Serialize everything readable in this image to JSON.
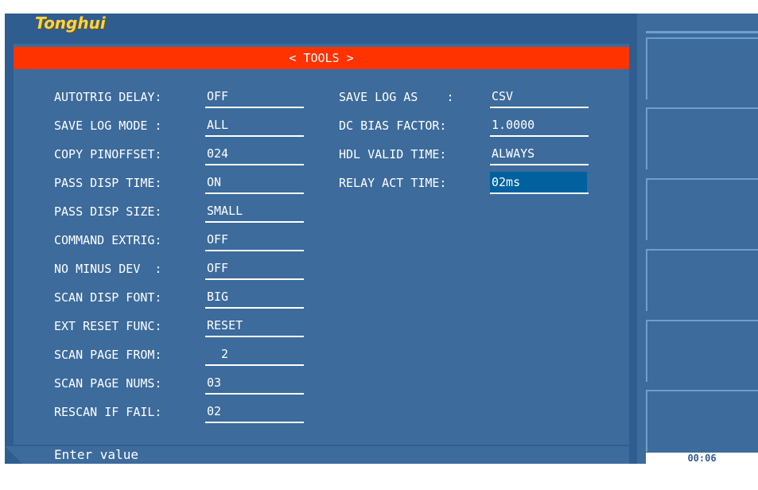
{
  "brand": "Tonghui",
  "title": "< TOOLS >",
  "left_items": [
    {
      "label": "AUTOTRIG DELAY:",
      "value": "OFF"
    },
    {
      "label": "SAVE LOG MODE :",
      "value": "ALL"
    },
    {
      "label": "COPY PINOFFSET:",
      "value": "024"
    },
    {
      "label": "PASS DISP TIME:",
      "value": "ON"
    },
    {
      "label": "PASS DISP SIZE:",
      "value": "SMALL"
    },
    {
      "label": "COMMAND EXTRIG:",
      "value": "OFF"
    },
    {
      "label": "NO MINUS DEV  :",
      "value": "OFF"
    },
    {
      "label": "SCAN DISP FONT:",
      "value": "BIG"
    },
    {
      "label": "EXT RESET FUNC:",
      "value": "RESET"
    },
    {
      "label": "SCAN PAGE FROM:",
      "value": "  2"
    },
    {
      "label": "SCAN PAGE NUMS:",
      "value": "03"
    },
    {
      "label": "RESCAN IF FAIL:",
      "value": "02"
    }
  ],
  "right_items": [
    {
      "label": "SAVE LOG AS    :",
      "value": "CSV"
    },
    {
      "label": "DC BIAS FACTOR:",
      "value": "1.0000"
    },
    {
      "label": "HDL VALID TIME:",
      "value": "ALWAYS"
    },
    {
      "label": "RELAY ACT TIME:",
      "value": "02ms"
    }
  ],
  "status_text": "Enter value",
  "clock": "00:06",
  "colors": {
    "background": "#2f5d8f",
    "panel": "#3c6b9c",
    "title_bar": "#ff3300",
    "selected": "#00619e",
    "brand": "#ffd24a"
  }
}
